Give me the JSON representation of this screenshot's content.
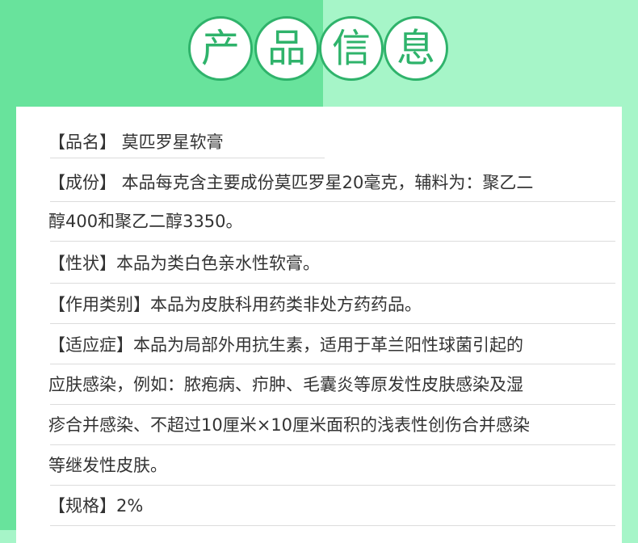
{
  "title": {
    "chars": [
      "产",
      "品",
      "信",
      "息"
    ]
  },
  "info": {
    "name_line": "【品名】 莫匹罗星软膏",
    "composition_line1": "【成份】 本品每克含主要成份莫匹罗星20毫克，辅料为：聚乙二",
    "composition_line2": "醇400和聚乙二醇3350。",
    "appearance_line": "【性状】本品为类白色亲水性软膏。",
    "category_line": "【作用类别】本品为皮肤科用药类非处方药药品。",
    "indication_line1": "【适应症】本品为局部外用抗生素，适用于革兰阳性球菌引起的",
    "indication_line2": "应肤感染，例如：脓疱病、疖肿、毛囊炎等原发性皮肤感染及湿",
    "indication_line3": "疹合并感染、不超过10厘米×10厘米面积的浅表性创伤合并感染",
    "indication_line4": "等继发性皮肤。",
    "spec_line": "【规格】2%"
  },
  "colors": {
    "bg_left": "#68e39c",
    "bg_right": "#a6f5c8",
    "accent": "#2fb36b",
    "text": "#333333"
  }
}
